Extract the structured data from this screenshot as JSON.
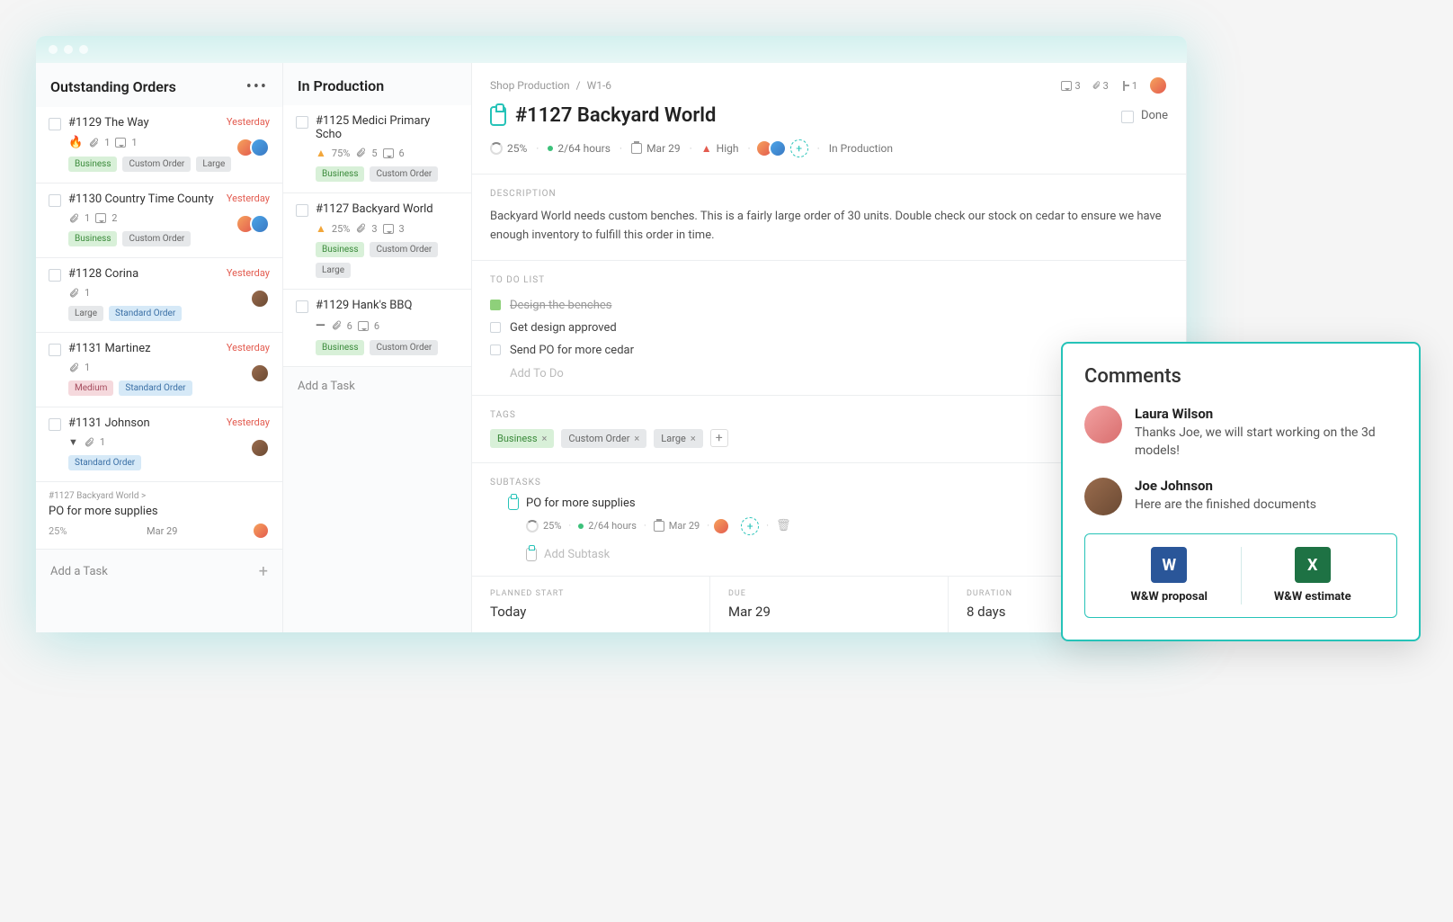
{
  "columns": {
    "outstanding": {
      "title": "Outstanding Orders",
      "addTask": "Add a Task",
      "cards": [
        {
          "title": "#1129 The Way",
          "due": "Yesterday",
          "priority": "flame",
          "attach": "1",
          "comments": "1",
          "tags": [
            [
              "Business",
              "green"
            ],
            [
              "Custom Order",
              "grey"
            ],
            [
              "Large",
              "grey"
            ]
          ],
          "avatars": [
            "a",
            "b"
          ]
        },
        {
          "title": "#1130 Country Time County",
          "due": "Yesterday",
          "priority": "none",
          "attach": "1",
          "comments": "2",
          "tags": [
            [
              "Business",
              "green"
            ],
            [
              "Custom Order",
              "grey"
            ]
          ],
          "avatars": [
            "a",
            "b"
          ]
        },
        {
          "title": "#1128 Corina",
          "due": "Yesterday",
          "priority": "none",
          "attach": "1",
          "comments": "",
          "tags": [
            [
              "Large",
              "grey"
            ],
            [
              "Standard Order",
              "blue"
            ]
          ],
          "avatars": [
            "c"
          ]
        },
        {
          "title": "#1131 Martinez",
          "due": "Yesterday",
          "priority": "none",
          "attach": "1",
          "comments": "",
          "tags": [
            [
              "Medium",
              "pink"
            ],
            [
              "Standard Order",
              "blue"
            ]
          ],
          "avatars": [
            "c"
          ]
        },
        {
          "title": "#1131 Johnson",
          "due": "Yesterday",
          "priority": "down",
          "attach": "1",
          "comments": "",
          "tags": [
            [
              "Standard Order",
              "blue"
            ]
          ],
          "avatars": [
            "c"
          ]
        }
      ],
      "subcard": {
        "crumb": "#1127 Backyard World >",
        "title": "PO for more supplies",
        "progress": "25%",
        "date": "Mar 29"
      }
    },
    "production": {
      "title": "In Production",
      "addTask": "Add a Task",
      "cards": [
        {
          "title": "#1125 Medici Primary Scho",
          "due": "",
          "priority": "up",
          "progress": "75%",
          "attach": "5",
          "comments": "6",
          "tags": [
            [
              "Business",
              "green"
            ],
            [
              "Custom Order",
              "grey"
            ]
          ]
        },
        {
          "title": "#1127 Backyard World",
          "due": "",
          "priority": "up",
          "progress": "25%",
          "attach": "3",
          "comments": "3",
          "tags": [
            [
              "Business",
              "green"
            ],
            [
              "Custom Order",
              "grey"
            ],
            [
              "Large",
              "grey"
            ]
          ]
        },
        {
          "title": "#1129 Hank's BBQ",
          "due": "",
          "priority": "minus",
          "progress": "",
          "attach": "6",
          "comments": "6",
          "tags": [
            [
              "Business",
              "green"
            ],
            [
              "Custom Order",
              "grey"
            ]
          ]
        }
      ]
    }
  },
  "detail": {
    "breadcrumb": {
      "root": "Shop Production",
      "leaf": "W1-6"
    },
    "stats": {
      "comments": "3",
      "attach": "3",
      "subtasks": "1"
    },
    "doneLabel": "Done",
    "title": "#1127 Backyard World",
    "meta": {
      "progress": "25%",
      "hours": "2/64 hours",
      "date": "Mar 29",
      "priority": "High",
      "status": "In Production"
    },
    "description": {
      "label": "DESCRIPTION",
      "text": "Backyard World needs custom benches. This is a fairly large order of 30 units. Double check our stock on cedar to ensure we have enough inventory to fulfill this order in time."
    },
    "todo": {
      "label": "TO DO LIST",
      "items": [
        {
          "text": "Design the benches",
          "done": true
        },
        {
          "text": "Get design approved",
          "done": false
        },
        {
          "text": "Send PO for more cedar",
          "done": false
        }
      ],
      "add": "Add To Do"
    },
    "tags": {
      "label": "TAGS",
      "items": [
        "Business",
        "Custom Order",
        "Large"
      ]
    },
    "subtasks": {
      "label": "SUBTASKS",
      "item": {
        "title": "PO for more supplies",
        "progress": "25%",
        "hours": "2/64 hours",
        "date": "Mar 29"
      },
      "add": "Add Subtask"
    },
    "dates": {
      "planned": {
        "label": "PLANNED START",
        "value": "Today"
      },
      "due": {
        "label": "DUE",
        "value": "Mar 29"
      },
      "duration": {
        "label": "DURATION",
        "value": "8 days"
      }
    }
  },
  "comments": {
    "title": "Comments",
    "items": [
      {
        "name": "Laura Wilson",
        "text": "Thanks Joe, we will start working on the 3d models!",
        "avatar": "d"
      },
      {
        "name": "Joe Johnson",
        "text": "Here are the finished documents",
        "avatar": "c"
      }
    ],
    "attachments": [
      {
        "name": "W&W proposal",
        "type": "word"
      },
      {
        "name": "W&W estimate",
        "type": "excel"
      }
    ]
  }
}
